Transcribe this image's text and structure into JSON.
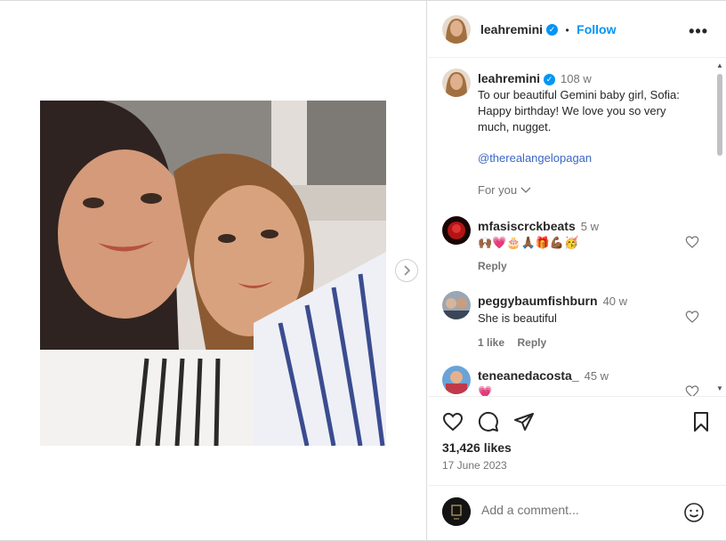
{
  "post": {
    "author": "leahremini",
    "follow_label": "Follow",
    "separator": "•",
    "more_label": "•••",
    "caption_time": "108 w",
    "caption_line1": "To our beautiful Gemini baby girl, Sofia:",
    "caption_line2": "Happy birthday! We love you so very",
    "caption_line3": "much, nugget.",
    "caption_mention": "@therealangelopagan",
    "for_you_label": "For you"
  },
  "comments": [
    {
      "username": "mfasiscrckbeats",
      "time": "5 w",
      "text": "🙌🏾💗🎂🙏🏾🎁💪🏾🥳",
      "reply": "Reply",
      "likes": ""
    },
    {
      "username": "peggybaumfishburn",
      "time": "40 w",
      "text": "She is beautiful",
      "reply": "Reply",
      "likes": "1 like"
    },
    {
      "username": "teneanedacosta_",
      "time": "45 w",
      "text": "💗",
      "reply": "",
      "likes": ""
    }
  ],
  "stats": {
    "likes": "31,426 likes",
    "date": "17 June 2023"
  },
  "add_comment": {
    "placeholder": "Add a comment..."
  },
  "colors": {
    "accent": "#0095f6",
    "mention": "#3a66c4",
    "secondary_text": "#737373"
  }
}
